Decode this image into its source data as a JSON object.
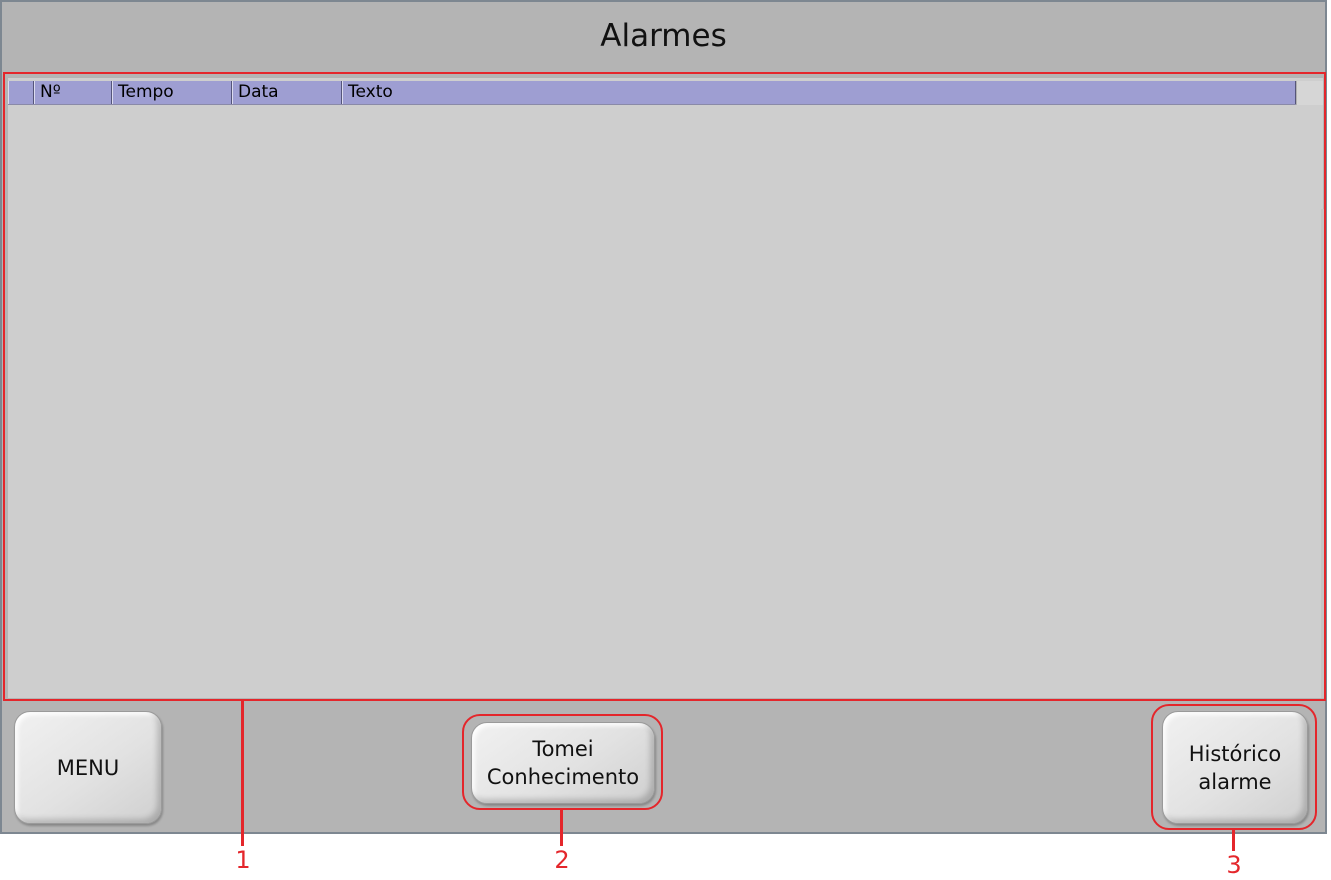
{
  "screen": {
    "title": "Alarmes"
  },
  "alarm_table": {
    "columns": [
      "Nº",
      "Tempo",
      "Data",
      "Texto"
    ],
    "rows": []
  },
  "buttons": {
    "menu": "MENU",
    "acknowledge_line1": "Tomei",
    "acknowledge_line2": "Conhecimento",
    "history_line1": "Histórico",
    "history_line2": "alarme"
  },
  "annotations": {
    "label_1": "1",
    "label_2": "2",
    "label_3": "3"
  },
  "colors": {
    "panel_bg": "#b4b4b4",
    "alarm_area_bg": "#cecece",
    "header_bg": "#9e9ed2",
    "annotation": "#e4262b"
  }
}
